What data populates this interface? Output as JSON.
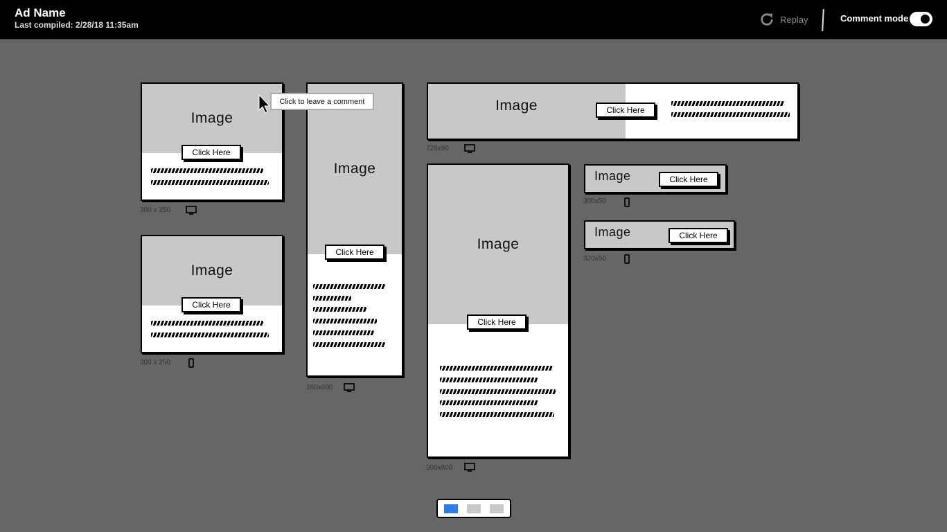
{
  "header": {
    "ad_name": "Ad Name",
    "last_compiled": "Last compiled: 2/28/18 11:35am",
    "replay_label": "Replay",
    "comment_mode_label": "Comment mode",
    "comment_mode_on": true
  },
  "tooltip": "Click to leave a comment",
  "ads": {
    "ad1": {
      "image": "Image",
      "cta": "Click Here",
      "size": "300 x 250",
      "device": "desktop-icon"
    },
    "ad2": {
      "image": "Image",
      "cta": "Click Here",
      "size": "300 x 250",
      "device": "mobile-icon"
    },
    "ad3": {
      "image": "Image",
      "cta": "Click Here",
      "size": "160x600",
      "device": "desktop-icon"
    },
    "ad4": {
      "image": "Image",
      "cta": "Click Here",
      "size": "728x90",
      "device": "desktop-icon"
    },
    "ad5": {
      "image": "Image",
      "cta": "Click Here",
      "size": "300x600",
      "device": "desktop-icon"
    },
    "ad6": {
      "image": "Image",
      "cta": "Click Here",
      "size": "300x50",
      "device": "mobile-icon"
    },
    "ad7": {
      "image": "Image",
      "cta": "Click Here",
      "size": "320x50",
      "device": "mobile-icon"
    }
  },
  "pager": {
    "pages": 3,
    "active": 1
  },
  "colors": {
    "accent": "#2f7de1",
    "background": "#666666",
    "image_placeholder": "#c8c8c8"
  }
}
